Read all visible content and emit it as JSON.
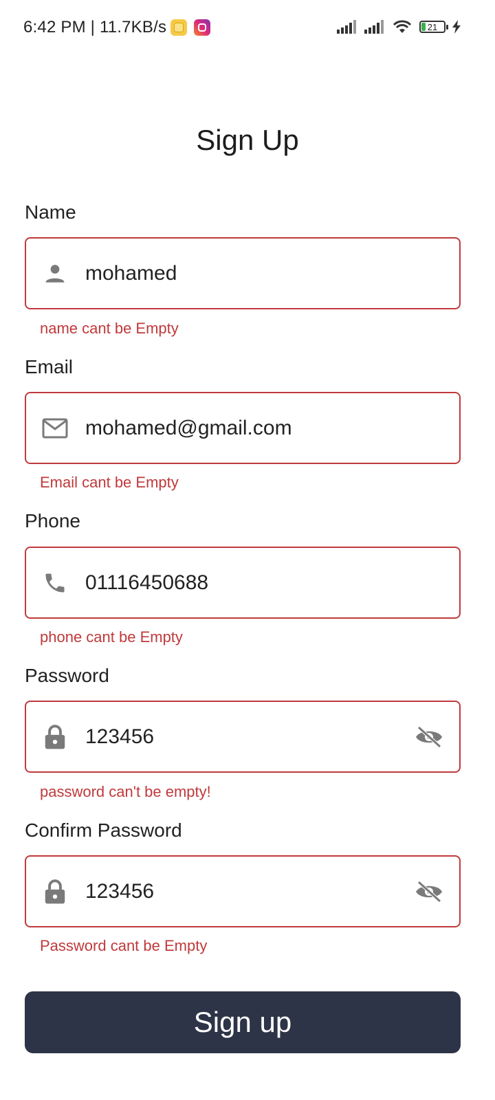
{
  "status_bar": {
    "time_speed": "6:42 PM | 11.7KB/s",
    "battery_level": "21"
  },
  "page": {
    "title": "Sign Up"
  },
  "form": {
    "name": {
      "label": "Name",
      "value": "mohamed",
      "error": "name cant be Empty",
      "icon": "person-icon"
    },
    "email": {
      "label": "Email",
      "value": "mohamed@gmail.com",
      "error": "Email cant be Empty",
      "icon": "mail-icon"
    },
    "phone": {
      "label": "Phone",
      "value": "01116450688",
      "error": "phone cant be Empty",
      "icon": "phone-icon"
    },
    "password": {
      "label": "Password",
      "value": "123456",
      "error": "password can't be empty!",
      "icon": "lock-icon",
      "toggle_icon": "eye-off-icon"
    },
    "confirm_password": {
      "label": "Confirm Password",
      "value": "123456",
      "error": "Password cant be Empty",
      "icon": "lock-icon",
      "toggle_icon": "eye-off-icon"
    }
  },
  "actions": {
    "submit_label": "Sign up"
  },
  "colors": {
    "error": "#c0393b",
    "button_bg": "#2d3447",
    "icon": "#7a7a7a"
  }
}
